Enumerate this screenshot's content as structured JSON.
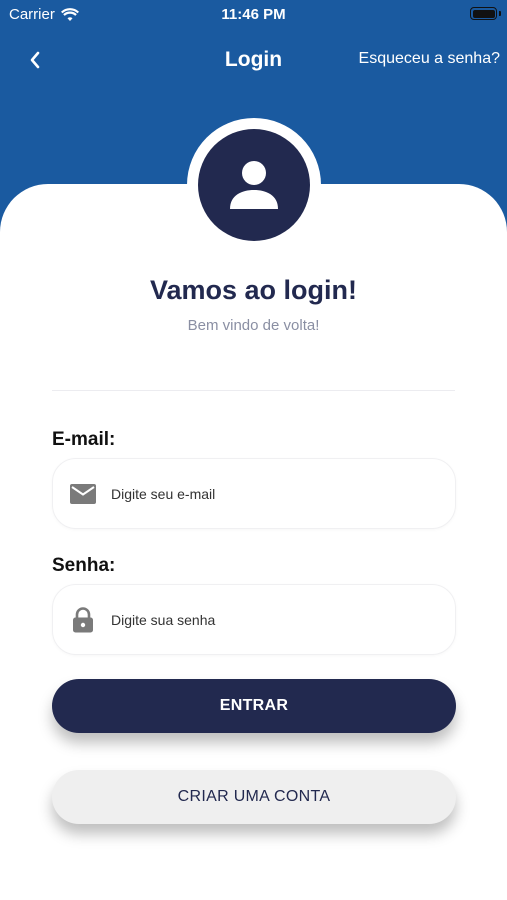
{
  "status_bar": {
    "carrier": "Carrier",
    "time": "11:46 PM"
  },
  "nav": {
    "title": "Login",
    "forgot_password": "Esqueceu a senha?"
  },
  "welcome": {
    "title": "Vamos ao login!",
    "subtitle": "Bem vindo de volta!"
  },
  "email": {
    "label": "E-mail:",
    "placeholder": "Digite seu e-mail",
    "value": "",
    "icon": "mail-icon"
  },
  "password": {
    "label": "Senha:",
    "placeholder": "Digite sua senha",
    "value": "",
    "icon": "lock-icon"
  },
  "buttons": {
    "login": "ENTRAR",
    "create_account": "CRIAR UMA CONTA"
  },
  "colors": {
    "header_blue": "#1a5aa0",
    "navy": "#22294f",
    "muted": "#8a8fa3",
    "secondary_button": "#efefef"
  }
}
